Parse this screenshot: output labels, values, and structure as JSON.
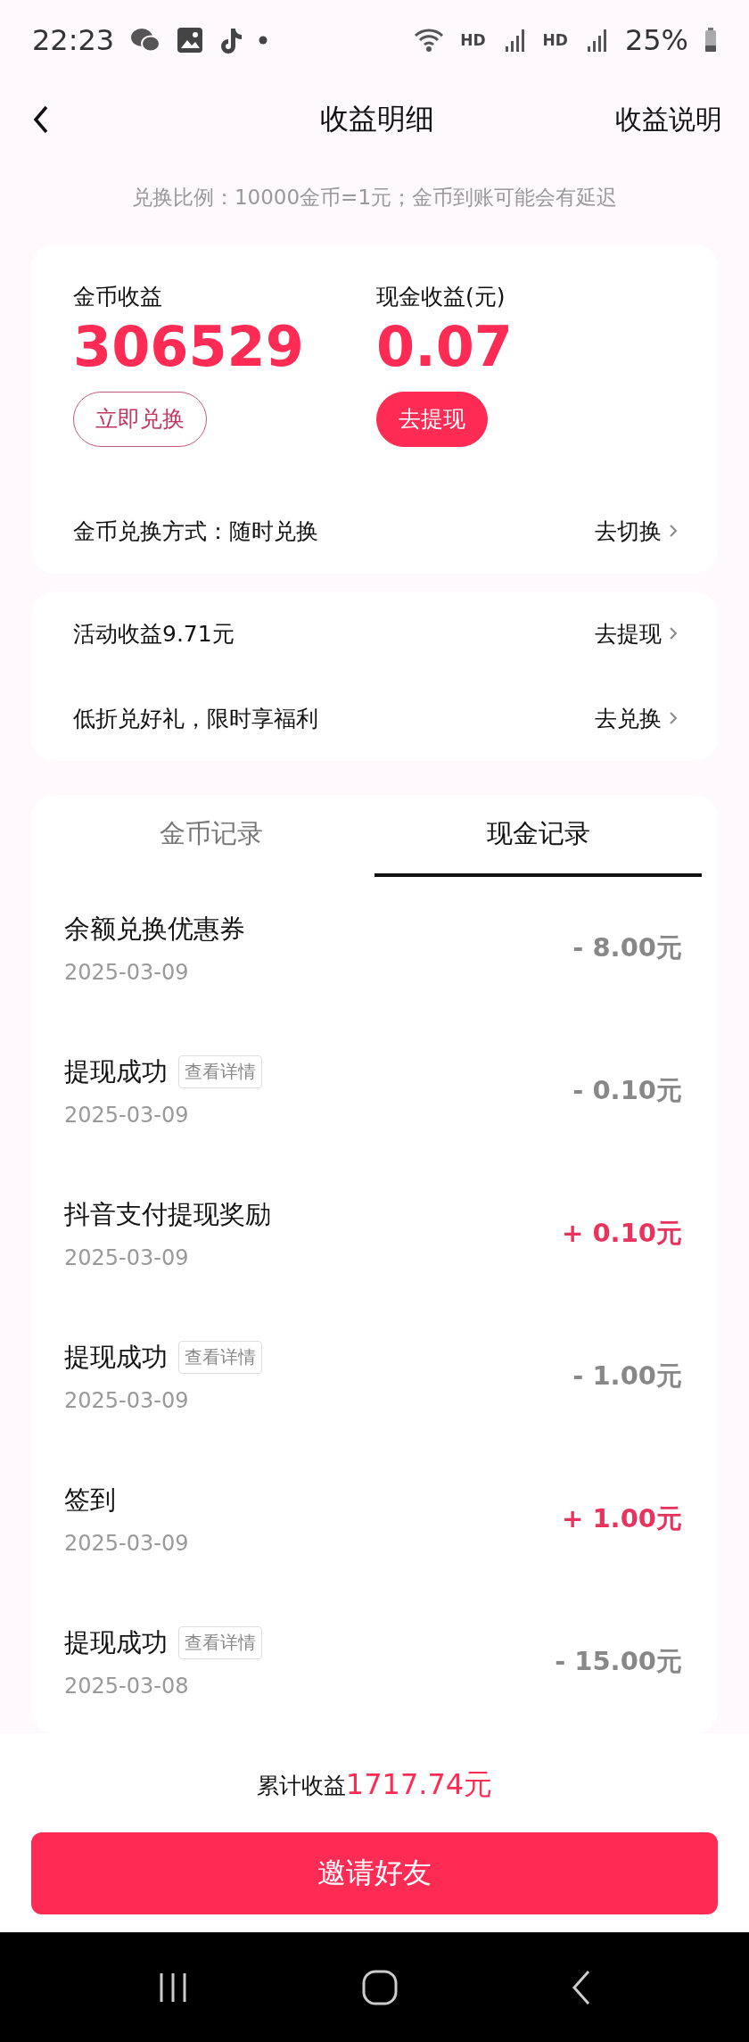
{
  "status_bar": {
    "time": "22:23",
    "network_labels": [
      "HD",
      "HD"
    ],
    "battery": "25%"
  },
  "header": {
    "title": "收益明细",
    "action": "收益说明"
  },
  "notice": "兑换比例：10000金币=1元；金币到账可能会有延迟",
  "balances": [
    {
      "label": "金币收益",
      "value": "306529",
      "button": "立即兑换",
      "kind": "outline"
    },
    {
      "label": "现金收益(元)",
      "value": "0.07",
      "button": "去提现",
      "kind": "filled"
    }
  ],
  "exchange_mode": {
    "label": "金币兑换方式：随时兑换",
    "action": "去切换"
  },
  "promos": [
    {
      "label": "活动收益9.71元",
      "action": "去提现"
    },
    {
      "label": "低折兑好礼，限时享福利",
      "action": "去兑换"
    }
  ],
  "tabs": [
    {
      "label": "金币记录",
      "selected": false
    },
    {
      "label": "现金记录",
      "selected": true
    }
  ],
  "records": [
    {
      "title": "余额兑换优惠券",
      "date": "2025-03-09",
      "amount": "- 8.00元",
      "kind": "expense"
    },
    {
      "title": "提现成功",
      "badge": "查看详情",
      "date": "2025-03-09",
      "amount": "- 0.10元",
      "kind": "expense"
    },
    {
      "title": "抖音支付提现奖励",
      "date": "2025-03-09",
      "amount": "+ 0.10元",
      "kind": "income"
    },
    {
      "title": "提现成功",
      "badge": "查看详情",
      "date": "2025-03-09",
      "amount": "- 1.00元",
      "kind": "expense"
    },
    {
      "title": "签到",
      "date": "2025-03-09",
      "amount": "+ 1.00元",
      "kind": "income"
    },
    {
      "title": "提现成功",
      "badge": "查看详情",
      "date": "2025-03-08",
      "amount": "- 15.00元",
      "kind": "expense"
    }
  ],
  "footer": {
    "total_label": "累计收益",
    "total_value": "1717.74元",
    "button": "邀请好友"
  }
}
